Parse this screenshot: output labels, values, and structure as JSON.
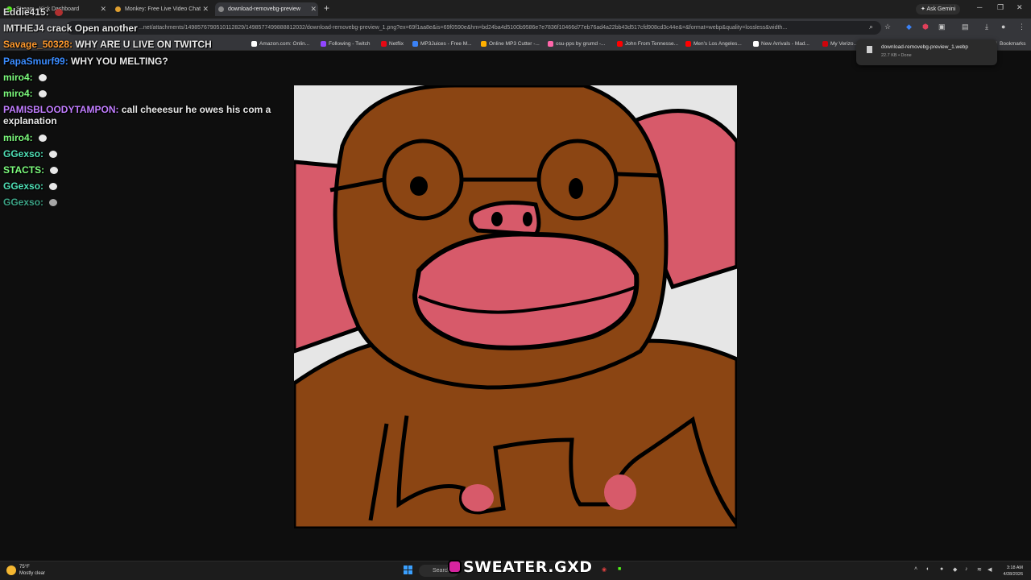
{
  "browser": {
    "tabs": [
      {
        "label": "Stream - Kick Dashboard",
        "active": false
      },
      {
        "label": "Monkey: Free Live Video Chat",
        "active": false
      },
      {
        "label": "download-removebg-preview",
        "active": true
      }
    ],
    "ask_gemini": "Ask Gemini",
    "address": "...net/attachments/1498576790510112829/1498577499888812032/download-removebg-preview_1.png?ex=69f1aa8e&is=69f0590e&hm=bd24ba4d5100b9586e7e7836f10466d77eb76ad4a22bb43d517cfd908cd3c44e&=&format=webp&quality=lossless&width...",
    "bookmarks": [
      {
        "label": "Amazon.com: Onlin..."
      },
      {
        "label": "Following - Twitch"
      },
      {
        "label": "Netflix"
      },
      {
        "label": "MP3Juices - Free M..."
      },
      {
        "label": "Online MP3 Cutter -..."
      },
      {
        "label": "osu-pps by grumd -..."
      },
      {
        "label": "John From Tennesse..."
      },
      {
        "label": "Men's Los Angeles..."
      },
      {
        "label": "New Arrivals - Mad..."
      },
      {
        "label": "My Verizo..."
      }
    ],
    "all_bookmarks": "Bookmarks",
    "download": {
      "filename": "download-removebg-preview_1.webp",
      "status": "22.7 KB • Done"
    }
  },
  "chat": [
    {
      "user": "Eddie415:",
      "text": "",
      "color": "#d8d8d8",
      "emote": true
    },
    {
      "user": "IMTHEJ4",
      "text": "crack Open another",
      "color": "#d8d8d8",
      "emote": false
    },
    {
      "user": "Savage_50328:",
      "text": "WHY ARE U LIVE ON TWITCH",
      "color": "#ff9a2e",
      "emote": false
    },
    {
      "user": "PapaSmurf99:",
      "text": "WHY YOU MELTING?",
      "color": "#3b8cff",
      "emote": false
    },
    {
      "user": "miro4:",
      "text": "",
      "color": "#7dfc7d",
      "emote": true
    },
    {
      "user": "miro4:",
      "text": "",
      "color": "#7dfc7d",
      "emote": true
    },
    {
      "user": "PAMISBLOODYTAMPON:",
      "text": "call cheeesur he owes his com a",
      "text2": "explanation",
      "color": "#c17dff",
      "emote": false
    },
    {
      "user": "miro4:",
      "text": "",
      "color": "#7dfc7d",
      "emote": true
    },
    {
      "user": "GGexso:",
      "text": "",
      "color": "#4fe0b6",
      "emote": true
    },
    {
      "user": "STACTS:",
      "text": "",
      "color": "#7dfc7d",
      "emote": true
    },
    {
      "user": "GGexso:",
      "text": "",
      "color": "#4fe0b6",
      "emote": true
    },
    {
      "user": "GGexso:",
      "text": "",
      "color": "#4fe0b6",
      "emote": true
    }
  ],
  "colors": {
    "fur": "#8b4513",
    "skin": "#d75a6a",
    "bg": "#e6e6e6",
    "outline": "#000000"
  },
  "taskbar": {
    "weather_temp": "75°F",
    "weather_desc": "Mostly clear",
    "search": "Search",
    "watermark": "SWEATER.GXD",
    "time": "3:18 AM",
    "date": "4/28/2026"
  }
}
